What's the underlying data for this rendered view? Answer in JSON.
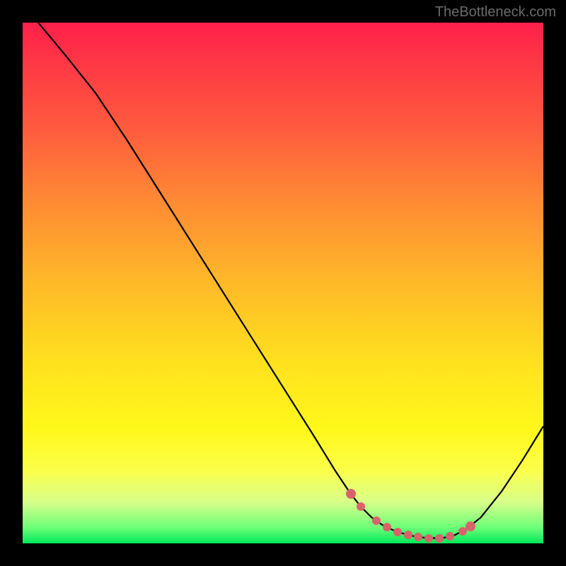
{
  "watermark": "TheBottleneck.com",
  "chart_data": {
    "type": "line",
    "title": "",
    "xlabel": "",
    "ylabel": "",
    "xlim": [
      0,
      100
    ],
    "ylim": [
      0,
      100
    ],
    "grid": false,
    "series": [
      {
        "name": "curve",
        "x": [
          3,
          8,
          14,
          20,
          26,
          32,
          38,
          44,
          50,
          56,
          60,
          63,
          65,
          67,
          69,
          71,
          73,
          75,
          77,
          79,
          81,
          83,
          85,
          88,
          92,
          96,
          100
        ],
        "y": [
          100,
          94,
          86.5,
          77.5,
          68,
          58.5,
          49,
          39.5,
          30,
          20.5,
          14,
          9.5,
          7,
          5,
          3.6,
          2.6,
          1.9,
          1.4,
          1.1,
          1.0,
          1.1,
          1.6,
          2.6,
          5,
          10,
          16,
          22.5
        ],
        "color": "#000000"
      }
    ],
    "markers": {
      "name": "highlight-dots",
      "color": "#d9636b",
      "points": [
        {
          "x": 63,
          "y": 9.5
        },
        {
          "x": 65,
          "y": 7
        },
        {
          "x": 68,
          "y": 4.3
        },
        {
          "x": 70,
          "y": 3.1
        },
        {
          "x": 72,
          "y": 2.2
        },
        {
          "x": 74,
          "y": 1.6
        },
        {
          "x": 76,
          "y": 1.2
        },
        {
          "x": 78,
          "y": 1.0
        },
        {
          "x": 80,
          "y": 1.0
        },
        {
          "x": 82,
          "y": 1.3
        },
        {
          "x": 84.5,
          "y": 2.3
        },
        {
          "x": 86,
          "y": 3.3
        }
      ]
    },
    "background_gradient": {
      "top": "#ff1f4b",
      "bottom": "#00e85a"
    }
  }
}
